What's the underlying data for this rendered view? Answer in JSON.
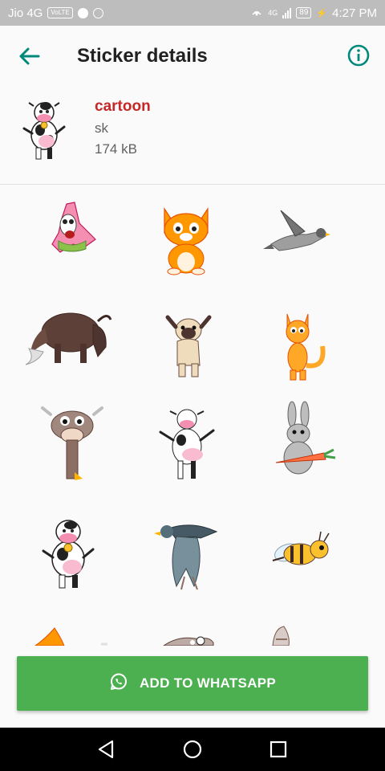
{
  "status_bar": {
    "carrier": "Jio 4G",
    "volte_badge": "VoLTE",
    "network_badge": "4G",
    "battery": "89",
    "time": "4:27 PM"
  },
  "toolbar": {
    "title": "Sticker details",
    "back_icon": "arrow-back-icon",
    "info_icon": "info-icon"
  },
  "pack": {
    "name": "cartoon",
    "publisher": "sk",
    "size": "174 kB"
  },
  "stickers": [
    {
      "name": "patrick-star-sticker"
    },
    {
      "name": "orange-kitten-sticker"
    },
    {
      "name": "flying-pigeon-sticker"
    },
    {
      "name": "buffalo-sticker"
    },
    {
      "name": "dabbing-pug-sticker"
    },
    {
      "name": "scared-cat-sticker"
    },
    {
      "name": "goofy-cow-sticker"
    },
    {
      "name": "dancing-cow-sticker"
    },
    {
      "name": "rabbit-carrot-sticker"
    },
    {
      "name": "cow-bell-sticker"
    },
    {
      "name": "flying-eagle-sticker"
    },
    {
      "name": "cartoon-bee-sticker"
    },
    {
      "name": "partial-sticker-1"
    },
    {
      "name": "partial-sticker-2"
    },
    {
      "name": "partial-sticker-3"
    }
  ],
  "add_button": {
    "label": "ADD TO WHATSAPP",
    "icon": "whatsapp-icon"
  },
  "colors": {
    "accent": "#00897b",
    "pack_name": "#c62828",
    "add_button": "#4caf50"
  },
  "nav_bar": {
    "back": "nav-back-icon",
    "home": "nav-home-icon",
    "recents": "nav-recents-icon"
  }
}
